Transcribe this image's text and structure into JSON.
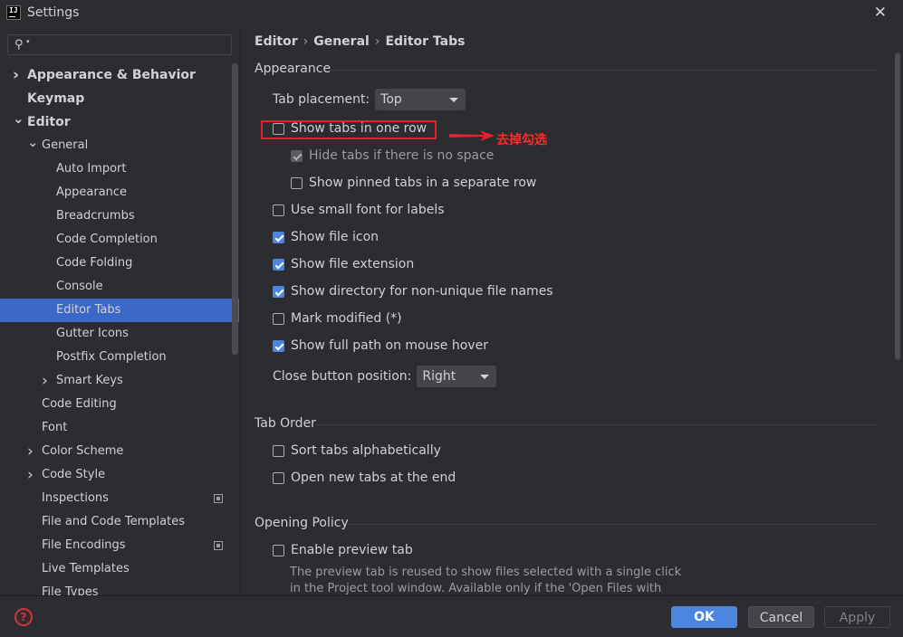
{
  "window": {
    "title": "Settings",
    "app_icon_text": "IJ"
  },
  "search": {
    "placeholder": "",
    "value": ""
  },
  "tree": [
    {
      "label": "Appearance & Behavior",
      "level": 0,
      "bold": true,
      "chevron": "right"
    },
    {
      "label": "Keymap",
      "level": 0,
      "bold": true,
      "chevron": "none"
    },
    {
      "label": "Editor",
      "level": 0,
      "bold": true,
      "chevron": "down"
    },
    {
      "label": "General",
      "level": 1,
      "bold": false,
      "chevron": "down"
    },
    {
      "label": "Auto Import",
      "level": 2
    },
    {
      "label": "Appearance",
      "level": 2
    },
    {
      "label": "Breadcrumbs",
      "level": 2
    },
    {
      "label": "Code Completion",
      "level": 2
    },
    {
      "label": "Code Folding",
      "level": 2
    },
    {
      "label": "Console",
      "level": 2
    },
    {
      "label": "Editor Tabs",
      "level": 2,
      "selected": true
    },
    {
      "label": "Gutter Icons",
      "level": 2
    },
    {
      "label": "Postfix Completion",
      "level": 2
    },
    {
      "label": "Smart Keys",
      "level": 2,
      "chevron": "right"
    },
    {
      "label": "Code Editing",
      "level": 1
    },
    {
      "label": "Font",
      "level": 1
    },
    {
      "label": "Color Scheme",
      "level": 1,
      "chevron": "right"
    },
    {
      "label": "Code Style",
      "level": 1,
      "chevron": "right"
    },
    {
      "label": "Inspections",
      "level": 1,
      "icon": "copy-icon"
    },
    {
      "label": "File and Code Templates",
      "level": 1
    },
    {
      "label": "File Encodings",
      "level": 1,
      "icon": "copy-icon"
    },
    {
      "label": "Live Templates",
      "level": 1
    },
    {
      "label": "File Types",
      "level": 1
    }
  ],
  "breadcrumb": [
    "Editor",
    "General",
    "Editor Tabs"
  ],
  "appearance": {
    "title": "Appearance",
    "tab_placement_label": "Tab placement:",
    "tab_placement_value": "Top",
    "options": [
      {
        "label": "Show tabs in one row",
        "checked": false,
        "indent": 0
      },
      {
        "label": "Hide tabs if there is no space",
        "checked": true,
        "disabled": true,
        "indent": 1
      },
      {
        "label": "Show pinned tabs in a separate row",
        "checked": false,
        "indent": 1
      },
      {
        "label": "Use small font for labels",
        "checked": false,
        "indent": 0
      },
      {
        "label": "Show file icon",
        "checked": true,
        "indent": 0
      },
      {
        "label": "Show file extension",
        "checked": true,
        "indent": 0
      },
      {
        "label": "Show directory for non-unique file names",
        "checked": true,
        "indent": 0
      },
      {
        "label": "Mark modified (*)",
        "checked": false,
        "indent": 0
      },
      {
        "label": "Show full path on mouse hover",
        "checked": true,
        "indent": 0
      }
    ],
    "close_button_label": "Close button position:",
    "close_button_value": "Right"
  },
  "annotation": {
    "text": "去掉勾选",
    "color": "#ff2a2a"
  },
  "tab_order": {
    "title": "Tab Order",
    "options": [
      {
        "label": "Sort tabs alphabetically",
        "checked": false
      },
      {
        "label": "Open new tabs at the end",
        "checked": false
      }
    ]
  },
  "opening_policy": {
    "title": "Opening Policy",
    "options": [
      {
        "label": "Enable preview tab",
        "checked": false
      }
    ],
    "help_line1": "The preview tab is reused to show files selected with a single click",
    "help_line2": "in the Project tool window. Available only if the 'Open Files with"
  },
  "footer": {
    "help": "?",
    "ok": "OK",
    "cancel": "Cancel",
    "apply": "Apply"
  },
  "colors": {
    "accent": "#4d86e0",
    "selection": "#3b68c8",
    "annotation_red": "#e5222b"
  }
}
